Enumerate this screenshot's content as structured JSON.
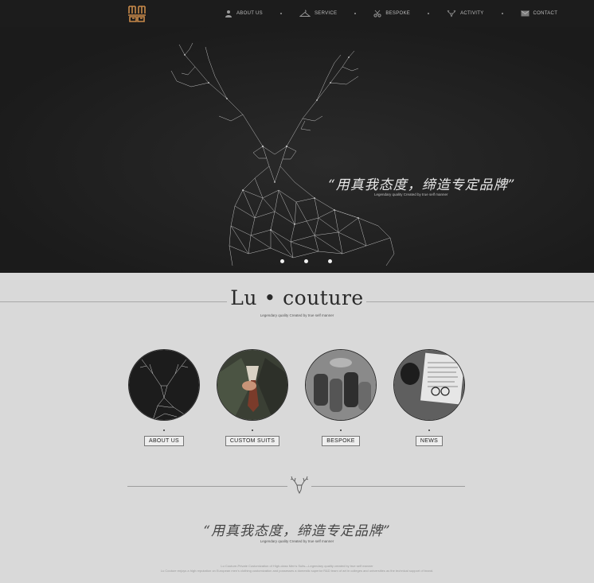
{
  "nav": {
    "items": [
      {
        "label": "ABOUT US",
        "icon": "person-icon"
      },
      {
        "label": "SERVICE",
        "icon": "hanger-icon"
      },
      {
        "label": "BESPOKE",
        "icon": "scissors-icon"
      },
      {
        "label": "ACTIVITY",
        "icon": "deer-head-icon"
      },
      {
        "label": "CONTACT",
        "icon": "mail-icon"
      }
    ]
  },
  "hero": {
    "quote": "“用真我态度，缔造专定品牌”",
    "tagline": "Legendary quality Created by true self manner",
    "slide_count": 3
  },
  "brand": {
    "title": "Lu • couture",
    "subtitle": "Legendary quality Created by true self manner"
  },
  "cards": [
    {
      "label": "ABOUT US",
      "image": "deer-wireframe"
    },
    {
      "label": "CUSTOM SUITS",
      "image": "suit-tie"
    },
    {
      "label": "BESPOKE",
      "image": "fabric-rolls"
    },
    {
      "label": "NEWS",
      "image": "newspaper-coffee"
    }
  ],
  "quote2": {
    "text": "“用真我态度，缔造专定品牌”",
    "subtitle": "Legendary quality Created by true self manner"
  },
  "footer": {
    "line1": "Lu Couture-Private Customization of High-class Men's Suits—Legendary quality created by true self manner",
    "line2": "Lu Couture enjoys a high reputation on European men's clothing customization and possesses a domestic superior R&D team of art in colleges and universities as the technical support of brand."
  },
  "colors": {
    "topbar": "#1c1c1c",
    "hero_bg": "#1b1b1b",
    "page_bg": "#d9d9d9",
    "logo": "#c98a4a"
  }
}
